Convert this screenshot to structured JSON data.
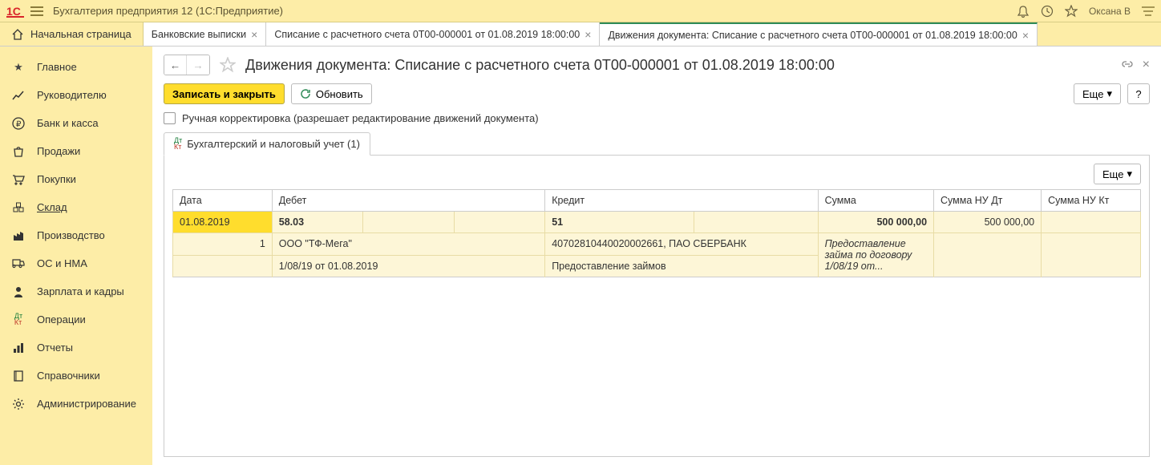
{
  "titlebar": {
    "app_title": "Бухгалтерия предприятия 12   (1С:Предприятие)",
    "user": "Оксана В"
  },
  "tabs": {
    "home": "Начальная страница",
    "items": [
      {
        "label": "Банковские выписки"
      },
      {
        "label": "Списание с расчетного счета 0Т00-000001 от 01.08.2019 18:00:00"
      },
      {
        "label": "Движения документа: Списание с расчетного счета 0Т00-000001 от 01.08.2019 18:00:00"
      }
    ]
  },
  "sidebar": {
    "items": [
      "Главное",
      "Руководителю",
      "Банк и касса",
      "Продажи",
      "Покупки",
      "Склад",
      "Производство",
      "ОС и НМА",
      "Зарплата и кадры",
      "Операции",
      "Отчеты",
      "Справочники",
      "Администрирование"
    ]
  },
  "page": {
    "title": "Движения документа: Списание с расчетного счета 0Т00-000001 от 01.08.2019 18:00:00",
    "save_close": "Записать и закрыть",
    "refresh": "Обновить",
    "more": "Еще",
    "help": "?",
    "manual_edit": "Ручная корректировка (разрешает редактирование движений документа)",
    "inner_tab": "Бухгалтерский и налоговый учет (1)"
  },
  "table": {
    "headers": [
      "Дата",
      "Дебет",
      "Кредит",
      "Сумма",
      "Сумма НУ Дт",
      "Сумма НУ Кт"
    ],
    "row1": {
      "date": "01.08.2019",
      "debit": "58.03",
      "credit": "51",
      "sum": "500 000,00",
      "sum_nu_dt": "500 000,00",
      "sum_nu_kt": ""
    },
    "row2": {
      "n": "1",
      "debit": "ООО \"ТФ-Мега\"",
      "credit": "40702810440020002661, ПАО СБЕРБАНК",
      "desc": "Предоставление займа по договору 1/08/19 от..."
    },
    "row3": {
      "debit": "1/08/19 от 01.08.2019",
      "credit": "Предоставление займов"
    }
  }
}
